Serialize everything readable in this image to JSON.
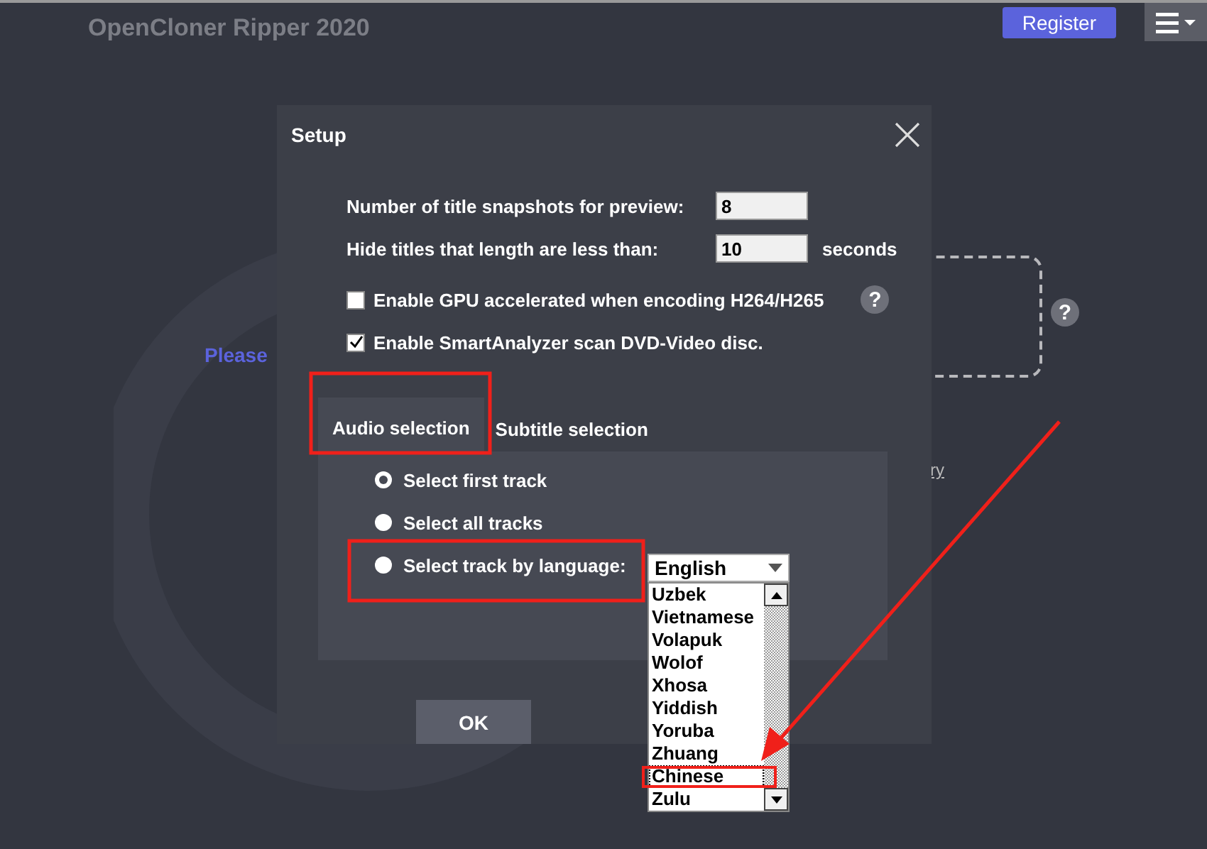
{
  "app": {
    "title": "OpenCloner Ripper 2020",
    "register_button": "Register",
    "hint_text": "Please",
    "link_text": "ry",
    "help_icon": "?"
  },
  "dialog": {
    "title": "Setup",
    "fields": [
      {
        "label": "Number of title snapshots for preview:",
        "value": "8"
      },
      {
        "label": "Hide titles that length are less than:",
        "value": "10",
        "unit": "seconds"
      }
    ],
    "checkboxes": [
      {
        "label": "Enable GPU accelerated when encoding H264/H265",
        "checked": false,
        "help_icon": "?"
      },
      {
        "label": "Enable SmartAnalyzer scan DVD-Video disc.",
        "checked": true
      }
    ],
    "tabs": [
      {
        "label": "Audio selection",
        "selected": true
      },
      {
        "label": "Subtitle selection",
        "selected": false
      }
    ],
    "radios": [
      {
        "label": "Select first track",
        "selected": true
      },
      {
        "label": "Select all tracks",
        "selected": false
      },
      {
        "label": "Select track by language:",
        "selected": false
      }
    ],
    "language_select": {
      "value": "English",
      "options": [
        {
          "label": "Uzbek",
          "selected": false
        },
        {
          "label": "Vietnamese",
          "selected": false
        },
        {
          "label": "Volapuk",
          "selected": false
        },
        {
          "label": "Wolof",
          "selected": false
        },
        {
          "label": "Xhosa",
          "selected": false
        },
        {
          "label": "Yiddish",
          "selected": false
        },
        {
          "label": "Yoruba",
          "selected": false
        },
        {
          "label": "Zhuang",
          "selected": false
        },
        {
          "label": "Chinese",
          "selected": true
        },
        {
          "label": "Zulu",
          "selected": false
        }
      ]
    },
    "ok_button": "OK"
  }
}
